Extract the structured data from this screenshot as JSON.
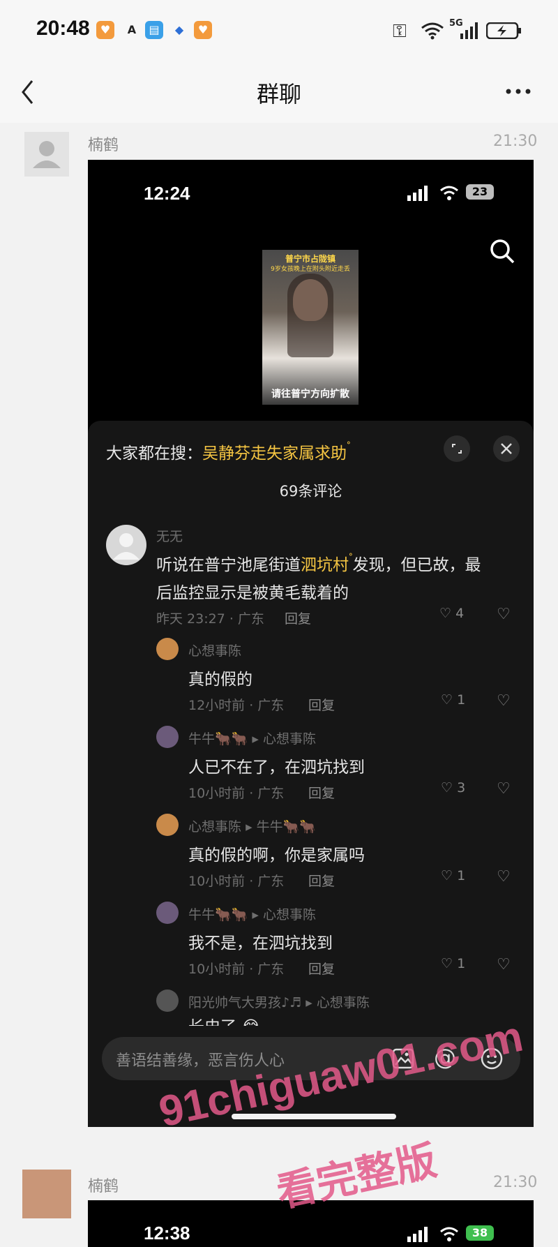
{
  "status_bar": {
    "time": "20:48",
    "network": "5G"
  },
  "header": {
    "title": "群聊"
  },
  "messages": [
    {
      "sender": "楠鹤",
      "time": "21:30"
    },
    {
      "sender": "楠鹤",
      "time": "21:30"
    }
  ],
  "screenshot": {
    "time": "12:24",
    "battery": "23",
    "video": {
      "title": "普宁市占陇镇",
      "subtitle": "9岁女孩晚上在附头附近走丢",
      "caption": "请往普宁方向扩散"
    },
    "search_prefix": "大家都在搜：",
    "search_term": "吴静芬走失家属求助",
    "comment_count": "69条评论",
    "comments": [
      {
        "user": "无无",
        "text_pre": "听说在普宁池尾街道",
        "link": "泗坑村",
        "text_post": "发现，但已故，最",
        "text_line2": "后监控显示是被黄毛载着的",
        "meta": "昨天 23:27 · 广东",
        "reply": "回复",
        "likes": "4"
      },
      {
        "user": "心想事陈",
        "reply_to": "",
        "text": "真的假的",
        "meta": "12小时前 · 广东",
        "reply": "回复",
        "likes": "1"
      },
      {
        "user": "牛牛🐂🐂",
        "reply_to": "心想事陈",
        "text": "人已不在了，在泗坑找到",
        "meta": "10小时前 · 广东",
        "reply": "回复",
        "likes": "3"
      },
      {
        "user": "心想事陈",
        "reply_to": "牛牛🐂🐂",
        "text": "真的假的啊，你是家属吗",
        "meta": "10小时前 · 广东",
        "reply": "回复",
        "likes": "1"
      },
      {
        "user": "牛牛🐂🐂",
        "reply_to": "心想事陈",
        "text": "我不是，在泗坑找到",
        "meta": "10小时前 · 广东",
        "reply": "回复",
        "likes": "1"
      },
      {
        "user": "阳光帅气大男孩♪♬",
        "reply_to": "心想事陈",
        "text": "长史了 😂"
      }
    ],
    "input_placeholder": "善语结善缘，恶言伤人心"
  },
  "screenshot2": {
    "time": "12:38",
    "battery": "38"
  },
  "watermark": {
    "line1": "91chiguaw01.com",
    "line2": "看完整版"
  },
  "colors": {
    "accent": "#f5c542",
    "watermark": "#e35a8a"
  }
}
